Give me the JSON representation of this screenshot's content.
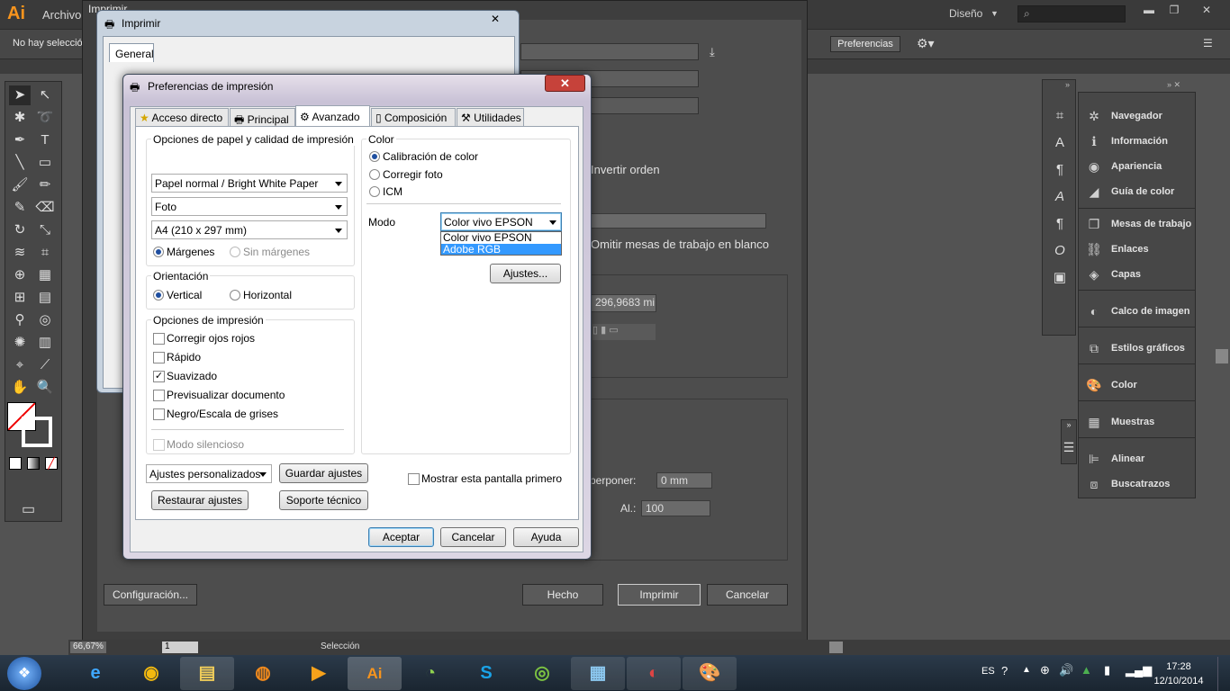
{
  "illustrator": {
    "logo": "Ai",
    "menu_file": "Archivo",
    "workspace": "Diseño",
    "no_selection": "No hay selección",
    "preferences_button": "Preferencias"
  },
  "print_dialog": {
    "title": "Imprimir",
    "invert_order": "Invertir orden",
    "omit_artboards": "Omitir mesas de trabajo en blanco",
    "width_value": "296,9683 mi",
    "overlap_label": "perponer:",
    "overlap_value": "0 mm",
    "height_label": "Al.:",
    "height_value": "100",
    "setup_button": "Configuración...",
    "done_button": "Hecho",
    "print_button": "Imprimir",
    "cancel_button": "Cancelar"
  },
  "imprimir_win": {
    "title": "Imprimir",
    "tab": "General"
  },
  "prefs": {
    "title": "Preferencias de impresión",
    "close": "✕",
    "tabs": [
      {
        "label": "Acceso directo"
      },
      {
        "label": "Principal"
      },
      {
        "label": "Avanzado"
      },
      {
        "label": "Composición"
      },
      {
        "label": "Utilidades"
      }
    ],
    "paper_group": {
      "title": "Opciones de papel y calidad de impresión",
      "paper_type": "Papel normal / Bright White Paper",
      "quality": "Foto",
      "size": "A4 (210 x 297 mm)",
      "margins": "Márgenes",
      "no_margins": "Sin márgenes"
    },
    "orientation": {
      "title": "Orientación",
      "vertical": "Vertical",
      "horizontal": "Horizontal"
    },
    "print_options": {
      "title": "Opciones de impresión",
      "red_eye": "Corregir ojos rojos",
      "fast": "Rápido",
      "smooth": "Suavizado",
      "preview": "Previsualizar documento",
      "grayscale": "Negro/Escala de grises",
      "silent": "Modo silencioso"
    },
    "color": {
      "title": "Color",
      "calibration": "Calibración de color",
      "photo_fix": "Corregir foto",
      "icm": "ICM",
      "mode_label": "Modo",
      "mode_value": "Color vivo EPSON",
      "options": [
        "Color vivo EPSON",
        "Adobe RGB"
      ],
      "settings_button": "Ajustes..."
    },
    "custom_settings": "Ajustes personalizados",
    "save_settings": "Guardar ajustes",
    "restore_defaults": "Restaurar ajustes",
    "tech_support": "Soporte técnico",
    "show_first": "Mostrar esta pantalla primero",
    "ok": "Aceptar",
    "cancel": "Cancelar",
    "help": "Ayuda"
  },
  "panels": {
    "group1": [
      "Navegador",
      "Información",
      "Apariencia",
      "Guía de color"
    ],
    "group2": [
      "Mesas de trabajo",
      "Enlaces",
      "Capas"
    ],
    "group3": [
      "Calco de imagen"
    ],
    "group4": [
      "Estilos gráficos"
    ],
    "group5": [
      "Color"
    ],
    "group6": [
      "Muestras"
    ],
    "group7": [
      "Alinear",
      "Buscatrazos"
    ]
  },
  "statusbar": {
    "zoom": "66,67%",
    "page": "1",
    "selection": "Selección"
  },
  "taskbar": {
    "lang": "ES",
    "time": "17:28",
    "date": "12/10/2014",
    "apps": [
      "internet-explorer",
      "chrome",
      "file-explorer",
      "firefox",
      "media-player",
      "illustrator",
      "picasa",
      "skype",
      "spotify",
      "control-panel",
      "chrome-icon-app",
      "paint"
    ]
  }
}
